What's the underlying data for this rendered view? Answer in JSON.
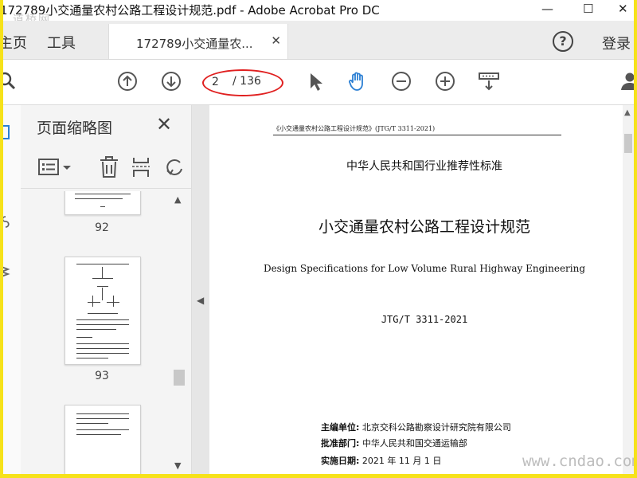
{
  "window": {
    "title": "172789小交通量农村公路工程设计规范.pdf - Adobe Acrobat Pro DC",
    "minimize": "—",
    "maximize": "☐",
    "close": "✕"
  },
  "tabs": {
    "home": "主页",
    "tools": "工具",
    "document": "172789小交通量农...",
    "document_close": "✕",
    "help": "?",
    "login": "登录"
  },
  "toolbar": {
    "current_page": "2",
    "total_pages": "/ 136"
  },
  "thumbnails": {
    "title": "页面缩略图",
    "close": "✕",
    "pages": [
      {
        "number": "92"
      },
      {
        "number": "93"
      }
    ]
  },
  "document": {
    "header": "《小交通量农村公路工程设计规范》(JTG/T 3311-2021)",
    "standard_type": "中华人民共和国行业推荐性标准",
    "title": "小交通量农村公路工程设计规范",
    "title_en": "Design Specifications for Low Volume Rural Highway Engineering",
    "code": "JTG/T 3311-2021",
    "editor_label": "主编单位:",
    "editor_value": "北京交科公路勘察设计研究院有限公司",
    "approver_label": "批准部门:",
    "approver_value": "中华人民共和国交通运输部",
    "date_label": "实施日期:",
    "date_value": "2021 年 11 月 1 日"
  },
  "watermarks": {
    "top_left": "道桥网",
    "bottom_right": "www.cndao.com"
  },
  "colors": {
    "frame_border": "#f6e21a",
    "page_ring": "#e02020",
    "hand_tool": "#2b7fd4"
  }
}
